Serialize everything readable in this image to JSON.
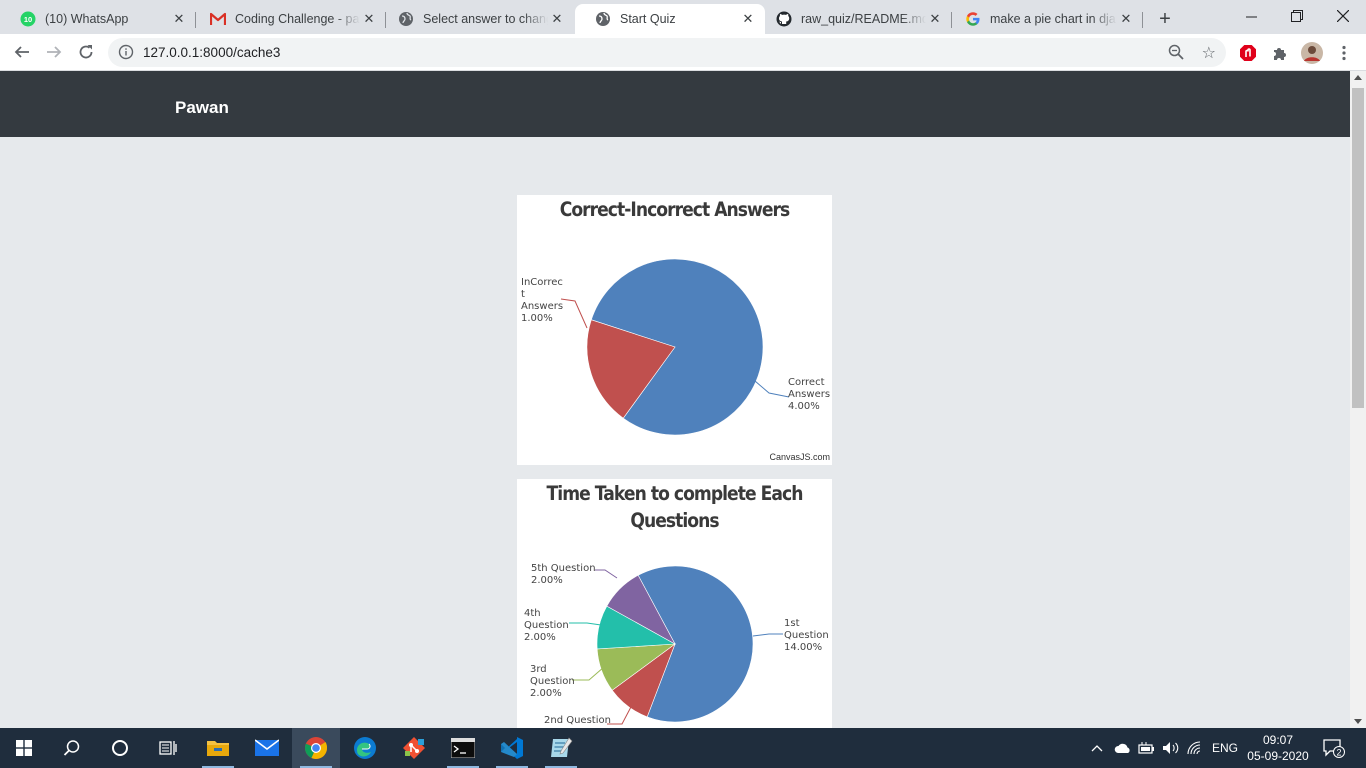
{
  "browser": {
    "tabs": [
      {
        "title": "(10) WhatsApp",
        "icon": "whatsapp-icon",
        "badge": "10"
      },
      {
        "title": "Coding Challenge - pawan",
        "icon": "gmail-icon"
      },
      {
        "title": "Select answer to change",
        "icon": "globe-icon"
      },
      {
        "title": "Start Quiz",
        "icon": "globe-icon",
        "active": true
      },
      {
        "title": "raw_quiz/README.md at master",
        "icon": "github-icon"
      },
      {
        "title": "make a pie chart in django",
        "icon": "google-icon"
      }
    ],
    "url": "127.0.0.1:8000/cache3"
  },
  "page": {
    "brand": "Pawan"
  },
  "chart_data": [
    {
      "type": "pie",
      "title": "Correct-Incorrect Answers",
      "credit": "CanvasJS.com",
      "series": [
        {
          "label_lines": [
            "Correct",
            "Answers",
            "4.00%"
          ],
          "value": 4,
          "color": "#4f81bc"
        },
        {
          "label_lines": [
            "InCorrec",
            "t",
            "Answers",
            "1.00%"
          ],
          "value": 1,
          "color": "#c0504e"
        }
      ]
    },
    {
      "type": "pie",
      "title_lines": [
        "Time Taken to complete Each",
        "Questions"
      ],
      "series": [
        {
          "label_lines": [
            "1st",
            "Question",
            "14.00%"
          ],
          "value": 14,
          "color": "#4f81bc"
        },
        {
          "label_lines": [
            "2nd Question"
          ],
          "value": 2,
          "color": "#c0504e"
        },
        {
          "label_lines": [
            "3rd",
            "Question",
            "2.00%"
          ],
          "value": 2,
          "color": "#9bbb58"
        },
        {
          "label_lines": [
            "4th",
            "Question",
            "2.00%"
          ],
          "value": 2,
          "color": "#23bfaa"
        },
        {
          "label_lines": [
            "5th Question",
            "2.00%"
          ],
          "value": 2,
          "color": "#8064a1"
        }
      ]
    }
  ],
  "taskbar": {
    "lang": "ENG",
    "time": "09:07",
    "date": "05-09-2020",
    "notifications": "2"
  }
}
